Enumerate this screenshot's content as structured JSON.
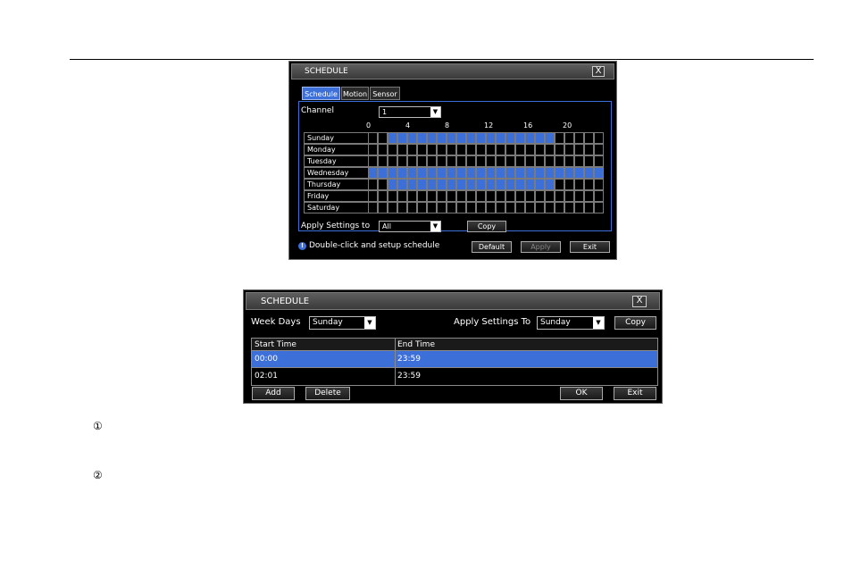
{
  "win1": {
    "title": "SCHEDULE",
    "close": "X",
    "tabs": [
      "Schedule",
      "Motion",
      "Sensor"
    ],
    "channel_label": "Channel",
    "channel_value": "1",
    "hours": [
      "0",
      "4",
      "8",
      "12",
      "16",
      "20"
    ],
    "days": [
      "Sunday",
      "Monday",
      "Tuesday",
      "Wednesday",
      "Thursday",
      "Friday",
      "Saturday"
    ],
    "schedule": {
      "Sunday": [
        [
          2,
          19
        ]
      ],
      "Monday": [],
      "Tuesday": [],
      "Wednesday": [
        [
          0,
          24
        ]
      ],
      "Thursday": [
        [
          2,
          19
        ]
      ],
      "Friday": [],
      "Saturday": []
    },
    "apply_label": "Apply Settings to",
    "apply_value": "All",
    "copy": "Copy",
    "hint": "Double-click and setup schedule",
    "default": "Default",
    "apply": "Apply",
    "exit": "Exit",
    "colors": {
      "accent": "#3d6fd8",
      "grid": "#7a7a7a"
    }
  },
  "win2": {
    "title": "SCHEDULE",
    "close": "X",
    "weekdays_label": "Week Days",
    "weekdays_value": "Sunday",
    "apply_label": "Apply Settings To",
    "apply_value": "Sunday",
    "copy": "Copy",
    "columns": [
      "Start Time",
      "End Time"
    ],
    "rows": [
      {
        "start": "00:00",
        "end": "23:59"
      },
      {
        "start": "02:01",
        "end": "23:59"
      }
    ],
    "add": "Add",
    "delete": "Delete",
    "ok": "OK",
    "exit": "Exit"
  },
  "markers": [
    "①",
    "②"
  ]
}
